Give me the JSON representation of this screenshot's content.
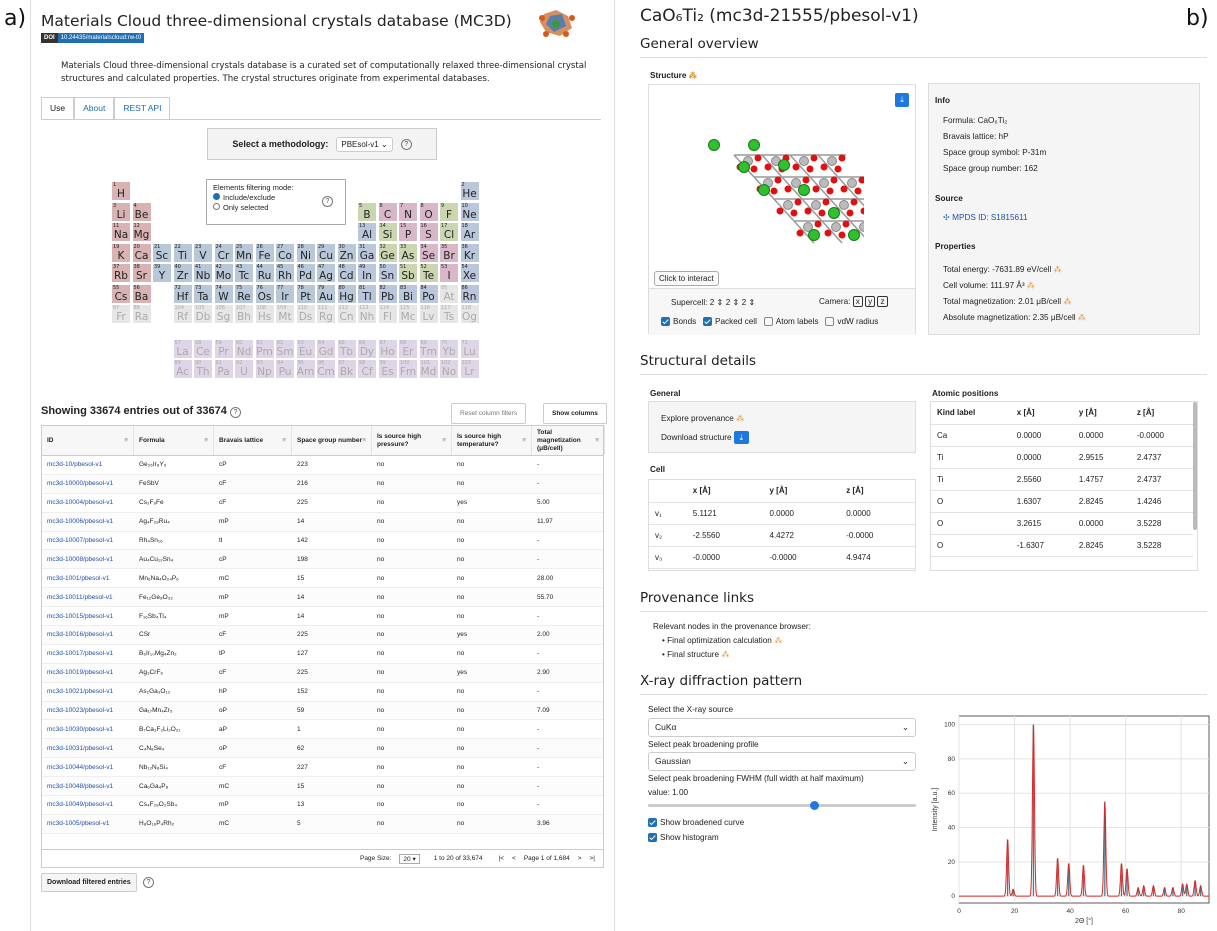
{
  "labels": {
    "a": "a)",
    "b": "b)"
  },
  "left": {
    "title": "Materials Cloud three-dimensional crystals database (MC3D)",
    "doi_key": "DOI",
    "doi_value": "10.24435/materialscloud:rw-t0",
    "intro": "Materials Cloud three-dimensional crystals database is a curated set of computationally relaxed three-dimensional crystal structures and calculated properties. The crystal structures originate from experimental databases.",
    "tabs": [
      "Use",
      "About",
      "REST API"
    ],
    "method_label": "Select a methodology:",
    "method_value": "PBEsol-v1 ⌄",
    "filter_title": "Elements filtering mode:",
    "filter_opt1": "Include/exclude",
    "filter_opt2": "Only selected",
    "showing": "Showing 33674 entries out of 33674",
    "reset_btn": "Reset column filters",
    "show_cols_btn": "Show columns",
    "columns": [
      "ID",
      "Formula",
      "Bravais lattice",
      "Space group number",
      "Is source high pressure?",
      "Is source high temperature?",
      "Total magnetization (μB/cell)"
    ],
    "rows": [
      [
        "mc3d-10/pbesol-v1",
        "Ge₂₆Ir₈Y₆",
        "cP",
        "223",
        "no",
        "no",
        "-"
      ],
      [
        "mc3d-10000/pbesol-v1",
        "FeSbV",
        "cF",
        "216",
        "no",
        "no",
        "-"
      ],
      [
        "mc3d-10004/pbesol-v1",
        "Cs₂F₆Fe",
        "cF",
        "225",
        "no",
        "yes",
        "5.00"
      ],
      [
        "mc3d-10006/pbesol-v1",
        "Ag₄F₂₈Ru₄",
        "mP",
        "14",
        "no",
        "no",
        "11.97"
      ],
      [
        "mc3d-10007/pbesol-v1",
        "Rh₄Sn₁₆",
        "tI",
        "142",
        "no",
        "no",
        "-"
      ],
      [
        "mc3d-10008/pbesol-v1",
        "Au₄Cu₁₂Sn₄",
        "cP",
        "198",
        "no",
        "no",
        "-"
      ],
      [
        "mc3d-1001/pbesol-v1",
        "Mn₆Na₄O₂₄P₆",
        "mC",
        "15",
        "no",
        "no",
        "28.00"
      ],
      [
        "mc3d-10011/pbesol-v1",
        "Fe₁₂Ge₈O₃₂",
        "mP",
        "14",
        "no",
        "no",
        "55.70"
      ],
      [
        "mc3d-10015/pbesol-v1",
        "F₁₆Sb₄Tl₄",
        "mP",
        "14",
        "no",
        "no",
        "-"
      ],
      [
        "mc3d-10016/pbesol-v1",
        "CSr",
        "cF",
        "225",
        "no",
        "yes",
        "2.00"
      ],
      [
        "mc3d-10017/pbesol-v1",
        "B₆Ir₁₀Mg₄Zn₂",
        "tP",
        "127",
        "no",
        "no",
        "-"
      ],
      [
        "mc3d-10019/pbesol-v1",
        "Ag₃CrF₆",
        "cF",
        "225",
        "no",
        "yes",
        "2.90"
      ],
      [
        "mc3d-10021/pbesol-v1",
        "As₂Ga₃O₁₂",
        "hP",
        "152",
        "no",
        "no",
        "-"
      ],
      [
        "mc3d-10023/pbesol-v1",
        "Ga₁₇Mn₄Zr₅",
        "oP",
        "59",
        "no",
        "no",
        "7.09"
      ],
      [
        "mc3d-10030/pbesol-v1",
        "B₇Ca₃F₂Li₃O₂₁",
        "aP",
        "1",
        "no",
        "no",
        "-"
      ],
      [
        "mc3d-10031/pbesol-v1",
        "C₄N₈Se₄",
        "oP",
        "62",
        "no",
        "no",
        "-"
      ],
      [
        "mc3d-10044/pbesol-v1",
        "Nb₁₂N₈Si₄",
        "cF",
        "227",
        "no",
        "no",
        "-"
      ],
      [
        "mc3d-10048/pbesol-v1",
        "Ca₆Ga₄P₈",
        "mC",
        "15",
        "no",
        "no",
        "-"
      ],
      [
        "mc3d-10049/pbesol-v1",
        "Cs₄F₂₈O₂Sb₄",
        "mP",
        "13",
        "no",
        "no",
        "-"
      ],
      [
        "mc3d-1005/pbesol-v1",
        "H₈O₁₆P₄Rh₂",
        "mC",
        "5",
        "no",
        "no",
        "3.96"
      ]
    ],
    "footer": {
      "page_size_label": "Page Size:",
      "page_size": "20 ▾",
      "range": "1 to 20 of 33,674",
      "page": "Page 1 of 1,684"
    },
    "download_btn": "Download filtered entries"
  },
  "periodic": [
    [
      "1",
      "H",
      1,
      1,
      "s"
    ],
    [
      "2",
      "He",
      18,
      1,
      "n"
    ],
    [
      "3",
      "Li",
      1,
      2,
      "s"
    ],
    [
      "4",
      "Be",
      2,
      2,
      "s"
    ],
    [
      "5",
      "B",
      13,
      2,
      "m"
    ],
    [
      "6",
      "C",
      14,
      2,
      "p"
    ],
    [
      "7",
      "N",
      15,
      2,
      "p"
    ],
    [
      "8",
      "O",
      16,
      2,
      "p"
    ],
    [
      "9",
      "F",
      17,
      2,
      "m"
    ],
    [
      "10",
      "Ne",
      18,
      2,
      "n"
    ],
    [
      "11",
      "Na",
      1,
      3,
      "s"
    ],
    [
      "12",
      "Mg",
      2,
      3,
      "s"
    ],
    [
      "13",
      "Al",
      13,
      3,
      "n"
    ],
    [
      "14",
      "Si",
      14,
      3,
      "m"
    ],
    [
      "15",
      "P",
      15,
      3,
      "p"
    ],
    [
      "16",
      "S",
      16,
      3,
      "p"
    ],
    [
      "17",
      "Cl",
      17,
      3,
      "m"
    ],
    [
      "18",
      "Ar",
      18,
      3,
      "n"
    ],
    [
      "19",
      "K",
      1,
      4,
      "s"
    ],
    [
      "20",
      "Ca",
      2,
      4,
      "s"
    ],
    [
      "21",
      "Sc",
      3,
      4,
      "d"
    ],
    [
      "22",
      "Ti",
      4,
      4,
      "d"
    ],
    [
      "23",
      "V",
      5,
      4,
      "d"
    ],
    [
      "24",
      "Cr",
      6,
      4,
      "d"
    ],
    [
      "25",
      "Mn",
      7,
      4,
      "d"
    ],
    [
      "26",
      "Fe",
      8,
      4,
      "d"
    ],
    [
      "27",
      "Co",
      9,
      4,
      "d"
    ],
    [
      "28",
      "Ni",
      10,
      4,
      "d"
    ],
    [
      "29",
      "Cu",
      11,
      4,
      "d"
    ],
    [
      "30",
      "Zn",
      12,
      4,
      "d"
    ],
    [
      "31",
      "Ga",
      13,
      4,
      "n"
    ],
    [
      "32",
      "Ge",
      14,
      4,
      "m"
    ],
    [
      "33",
      "As",
      15,
      4,
      "m"
    ],
    [
      "34",
      "Se",
      16,
      4,
      "p"
    ],
    [
      "35",
      "Br",
      17,
      4,
      "p"
    ],
    [
      "36",
      "Kr",
      18,
      4,
      "n"
    ],
    [
      "37",
      "Rb",
      1,
      5,
      "s"
    ],
    [
      "38",
      "Sr",
      2,
      5,
      "s"
    ],
    [
      "39",
      "Y",
      3,
      5,
      "d"
    ],
    [
      "40",
      "Zr",
      4,
      5,
      "d"
    ],
    [
      "41",
      "Nb",
      5,
      5,
      "d"
    ],
    [
      "42",
      "Mo",
      6,
      5,
      "d"
    ],
    [
      "43",
      "Tc",
      7,
      5,
      "d"
    ],
    [
      "44",
      "Ru",
      8,
      5,
      "d"
    ],
    [
      "45",
      "Rh",
      9,
      5,
      "d"
    ],
    [
      "46",
      "Pd",
      10,
      5,
      "d"
    ],
    [
      "47",
      "Ag",
      11,
      5,
      "d"
    ],
    [
      "48",
      "Cd",
      12,
      5,
      "d"
    ],
    [
      "49",
      "In",
      13,
      5,
      "n"
    ],
    [
      "50",
      "Sn",
      14,
      5,
      "n"
    ],
    [
      "51",
      "Sb",
      15,
      5,
      "m"
    ],
    [
      "52",
      "Te",
      16,
      5,
      "m"
    ],
    [
      "53",
      "I",
      17,
      5,
      "p"
    ],
    [
      "54",
      "Xe",
      18,
      5,
      "n"
    ],
    [
      "55",
      "Cs",
      1,
      6,
      "s"
    ],
    [
      "56",
      "Ba",
      2,
      6,
      "s"
    ],
    [
      "72",
      "Hf",
      4,
      6,
      "d"
    ],
    [
      "73",
      "Ta",
      5,
      6,
      "d"
    ],
    [
      "74",
      "W",
      6,
      6,
      "d"
    ],
    [
      "75",
      "Re",
      7,
      6,
      "d"
    ],
    [
      "76",
      "Os",
      8,
      6,
      "d"
    ],
    [
      "77",
      "Ir",
      9,
      6,
      "d"
    ],
    [
      "78",
      "Pt",
      10,
      6,
      "d"
    ],
    [
      "79",
      "Au",
      11,
      6,
      "d"
    ],
    [
      "80",
      "Hg",
      12,
      6,
      "d"
    ],
    [
      "81",
      "Tl",
      13,
      6,
      "n"
    ],
    [
      "82",
      "Pb",
      14,
      6,
      "n"
    ],
    [
      "83",
      "Bi",
      15,
      6,
      "n"
    ],
    [
      "84",
      "Po",
      16,
      6,
      "n"
    ],
    [
      "85",
      "At",
      17,
      6,
      "x"
    ],
    [
      "86",
      "Rn",
      18,
      6,
      "n"
    ],
    [
      "87",
      "Fr",
      1,
      7,
      "x"
    ],
    [
      "88",
      "Ra",
      2,
      7,
      "x"
    ],
    [
      "104",
      "Rf",
      4,
      7,
      "x"
    ],
    [
      "105",
      "Db",
      5,
      7,
      "x"
    ],
    [
      "106",
      "Sg",
      6,
      7,
      "x"
    ],
    [
      "107",
      "Bh",
      7,
      7,
      "x"
    ],
    [
      "108",
      "Hs",
      8,
      7,
      "x"
    ],
    [
      "109",
      "Mt",
      9,
      7,
      "x"
    ],
    [
      "110",
      "Ds",
      10,
      7,
      "x"
    ],
    [
      "111",
      "Rg",
      11,
      7,
      "x"
    ],
    [
      "112",
      "Cn",
      12,
      7,
      "x"
    ],
    [
      "113",
      "Nh",
      13,
      7,
      "x"
    ],
    [
      "114",
      "Fl",
      14,
      7,
      "x"
    ],
    [
      "115",
      "Mc",
      15,
      7,
      "x"
    ],
    [
      "116",
      "Lv",
      16,
      7,
      "x"
    ],
    [
      "117",
      "Ts",
      17,
      7,
      "x"
    ],
    [
      "118",
      "Og",
      18,
      7,
      "x"
    ],
    [
      "57",
      "La",
      4,
      8.7,
      "f"
    ],
    [
      "58",
      "Ce",
      5,
      8.7,
      "f"
    ],
    [
      "59",
      "Pr",
      6,
      8.7,
      "f"
    ],
    [
      "60",
      "Nd",
      7,
      8.7,
      "f"
    ],
    [
      "61",
      "Pm",
      8,
      8.7,
      "f"
    ],
    [
      "62",
      "Sm",
      9,
      8.7,
      "f"
    ],
    [
      "63",
      "Eu",
      10,
      8.7,
      "f"
    ],
    [
      "64",
      "Gd",
      11,
      8.7,
      "f"
    ],
    [
      "65",
      "Tb",
      12,
      8.7,
      "f"
    ],
    [
      "66",
      "Dy",
      13,
      8.7,
      "f"
    ],
    [
      "67",
      "Ho",
      14,
      8.7,
      "f"
    ],
    [
      "68",
      "Er",
      15,
      8.7,
      "f"
    ],
    [
      "69",
      "Tm",
      16,
      8.7,
      "f"
    ],
    [
      "70",
      "Yb",
      17,
      8.7,
      "f"
    ],
    [
      "71",
      "Lu",
      18,
      8.7,
      "f"
    ],
    [
      "89",
      "Ac",
      4,
      9.7,
      "f"
    ],
    [
      "90",
      "Th",
      5,
      9.7,
      "f"
    ],
    [
      "91",
      "Pa",
      6,
      9.7,
      "f"
    ],
    [
      "92",
      "U",
      7,
      9.7,
      "f"
    ],
    [
      "93",
      "Np",
      8,
      9.7,
      "f"
    ],
    [
      "94",
      "Pu",
      9,
      9.7,
      "f"
    ],
    [
      "95",
      "Am",
      10,
      9.7,
      "f"
    ],
    [
      "96",
      "Cm",
      11,
      9.7,
      "f"
    ],
    [
      "97",
      "Bk",
      12,
      9.7,
      "f"
    ],
    [
      "98",
      "Cf",
      13,
      9.7,
      "f"
    ],
    [
      "99",
      "Es",
      14,
      9.7,
      "f"
    ],
    [
      "100",
      "Fm",
      15,
      9.7,
      "f"
    ],
    [
      "101",
      "Md",
      16,
      9.7,
      "f"
    ],
    [
      "102",
      "No",
      17,
      9.7,
      "f"
    ],
    [
      "103",
      "Lr",
      18,
      9.7,
      "f"
    ]
  ],
  "element_colors": {
    "s": "#d9b3b3",
    "d": "#b8c8d8",
    "p": "#d8b8c8",
    "m": "#c9d6b0",
    "n": "#b9c6dc",
    "x": "#e6e6e6",
    "f": "#ded6e6"
  },
  "right": {
    "title_main": "CaO₆Ti₂ (mc3d-21555/pbesol-v1)",
    "general_overview": "General overview",
    "structure_label": "Structure",
    "click_interact": "Click to interact",
    "supercell_label": "Supercell:",
    "supercell_vals": [
      "2",
      "2",
      "2"
    ],
    "camera_label": "Camera:",
    "camera_btns": [
      "x",
      "y",
      "z"
    ],
    "opts": [
      "Bonds",
      "Packed cell",
      "Atom labels",
      "vdW radius"
    ],
    "info_title": "Info",
    "info": [
      "Formula: CaO₆Ti₂",
      "Bravais lattice: hP",
      "Space group symbol: P-31m",
      "Space group number: 162"
    ],
    "source_title": "Source",
    "source_link": "MPDS ID: S1815611",
    "props_title": "Properties",
    "props": [
      "Total energy: -7631.89 eV/cell",
      "Cell volume: 111.97 Å³",
      "Total magnetization: 2.01 μB/cell",
      "Absolute magnetization: 2.35 μB/cell"
    ],
    "structural_details": "Structural details",
    "general_title": "General",
    "explore": "Explore provenance",
    "download_struct": "Download structure",
    "cell_title": "Cell",
    "cell_headers": [
      "",
      "x [Å]",
      "y [Å]",
      "z [Å]"
    ],
    "cell_rows": [
      [
        "v₁",
        "5.1121",
        "0.0000",
        "0.0000"
      ],
      [
        "v₂",
        "-2.5560",
        "4.4272",
        "-0.0000"
      ],
      [
        "v₃",
        "-0.0000",
        "-0.0000",
        "4.9474"
      ]
    ],
    "atomic_title": "Atomic positions",
    "atomic_headers": [
      "Kind label",
      "x [Å]",
      "y [Å]",
      "z [Å]"
    ],
    "atomic_rows": [
      [
        "Ca",
        "0.0000",
        "0.0000",
        "-0.0000"
      ],
      [
        "Ti",
        "0.0000",
        "2.9515",
        "2.4737"
      ],
      [
        "Ti",
        "2.5560",
        "1.4757",
        "2.4737"
      ],
      [
        "O",
        "1.6307",
        "2.8245",
        "1.4246"
      ],
      [
        "O",
        "3.2615",
        "0.0000",
        "3.5228"
      ],
      [
        "O",
        "-1.6307",
        "2.8245",
        "3.5228"
      ]
    ],
    "prov_title": "Provenance links",
    "prov_intro": "Relevant nodes in the provenance browser:",
    "prov_items": [
      "Final optimization calculation",
      "Final structure"
    ],
    "xrd_title": "X-ray diffraction pattern",
    "xray_label": "Select the X-ray source",
    "xray_value": "CuKα",
    "peak_label": "Select peak broadening profile",
    "peak_value": "Gaussian",
    "fwhm_label": "Select peak broadening FWHM (full width at half maximum)",
    "fwhm_value": "value: 1.00",
    "fwhm_fraction": 0.62,
    "show_broadened": "Show broadened curve",
    "show_histogram": "Show histogram"
  },
  "chart_data": {
    "type": "line",
    "xlabel": "2Θ [°]",
    "ylabel": "Intensity [a.u.]",
    "xlim": [
      0,
      90
    ],
    "ylim": [
      -4,
      105
    ],
    "xticks": [
      0,
      20,
      40,
      60,
      80
    ],
    "yticks": [
      0,
      20,
      40,
      60,
      80,
      100
    ],
    "peaks": [
      [
        17.5,
        33
      ],
      [
        19.5,
        4
      ],
      [
        26.8,
        100
      ],
      [
        35.5,
        22
      ],
      [
        39.5,
        19
      ],
      [
        44.8,
        18
      ],
      [
        52.5,
        55
      ],
      [
        58.5,
        19
      ],
      [
        60.5,
        16
      ],
      [
        64.5,
        5
      ],
      [
        66.5,
        6
      ],
      [
        70,
        6
      ],
      [
        74,
        5
      ],
      [
        77,
        5
      ],
      [
        80.5,
        7
      ],
      [
        82,
        7
      ],
      [
        85,
        9
      ],
      [
        87,
        6
      ]
    ],
    "series_colors": {
      "broadened": "#d62728",
      "histogram": "#4a7d8c"
    }
  }
}
